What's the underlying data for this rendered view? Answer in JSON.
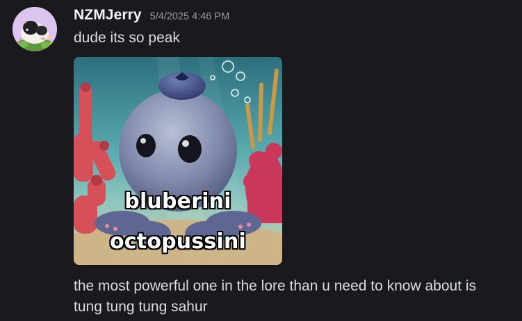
{
  "message": {
    "username": "NZMJerry",
    "timestamp": "5/4/2025 4:46 PM",
    "text": "dude its so peak",
    "attachment": {
      "caption_line_1": "bluberini",
      "caption_line_2": "octopussini"
    },
    "followup_lines": [
      "the most powerful one in the lore than u need to know about is",
      "tung tung tung sahur"
    ]
  },
  "colors": {
    "background": "#1a1a1e",
    "username": "#f2f3f5",
    "timestamp": "#949ba4",
    "text": "#dbdee1"
  },
  "icons": {
    "avatar": "guinea-pig-avatar"
  }
}
